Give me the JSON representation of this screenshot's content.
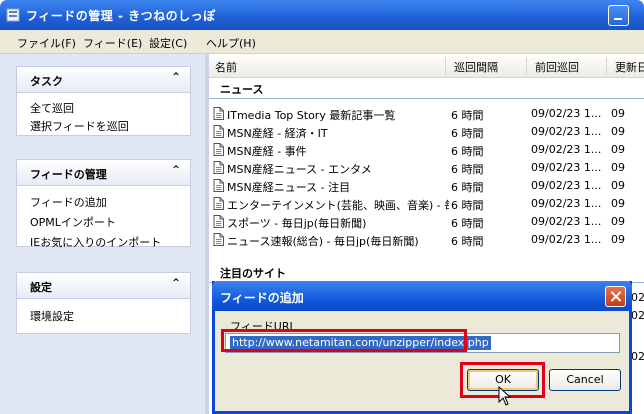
{
  "window": {
    "title": "フィードの管理 - きつねのしっぽ"
  },
  "menu": [
    "ファイル(F)",
    "フィード(E)",
    "設定(C)",
    "ヘルプ(H)"
  ],
  "sidebar": {
    "groups": [
      {
        "title": "タスク",
        "items": [
          "全て巡回",
          "選択フィードを巡回"
        ]
      },
      {
        "title": "フィードの管理",
        "items": [
          "フィードの追加",
          "OPMLインポート",
          "IEお気に入りのインポート"
        ]
      },
      {
        "title": "設定",
        "items": [
          "環境設定"
        ]
      }
    ]
  },
  "list": {
    "columns": [
      "名前",
      "巡回間隔",
      "前回巡回",
      "更新日"
    ],
    "groups": [
      {
        "title": "ニュース",
        "rows": [
          {
            "name": "ITmedia Top Story 最新記事一覧",
            "interval": "6 時間",
            "prev": "09/02/23 1...",
            "upd": "09"
          },
          {
            "name": "MSN産経 - 経済・IT",
            "interval": "6 時間",
            "prev": "09/02/23 1...",
            "upd": "09"
          },
          {
            "name": "MSN産経 - 事件",
            "interval": "6 時間",
            "prev": "09/02/23 1...",
            "upd": "09"
          },
          {
            "name": "MSN産経ニュース - エンタメ",
            "interval": "6 時間",
            "prev": "09/02/23 1...",
            "upd": "09"
          },
          {
            "name": "MSN産経ニュース - 注目",
            "interval": "6 時間",
            "prev": "09/02/23 1...",
            "upd": "09"
          },
          {
            "name": "エンターテインメント(芸能、映画、音楽) - 毎...",
            "interval": "6 時間",
            "prev": "09/02/23 1...",
            "upd": "09"
          },
          {
            "name": "スポーツ - 毎日jp(毎日新聞)",
            "interval": "6 時間",
            "prev": "09/02/23 1...",
            "upd": "09"
          },
          {
            "name": "ニュース速報(総合) - 毎日jp(毎日新聞)",
            "interval": "6 時間",
            "prev": "09/02/23 1...",
            "upd": "09"
          }
        ]
      },
      {
        "title": "注目のサイト",
        "rows": []
      }
    ],
    "partial_dates": [
      "02",
      "02",
      "02"
    ]
  },
  "dialog": {
    "title": "フィードの追加",
    "field_label": "フィードURL",
    "url_value": "http://www.netamitan.com/unzipper/index.php",
    "ok_label": "OK",
    "cancel_label": "Cancel"
  },
  "colors": {
    "titlebar": "#1f5fd6",
    "highlight": "#e0001a",
    "selection": "#316ac5"
  },
  "icons": [
    "app-icon",
    "minimize-icon",
    "collapse-icon",
    "rss-feed-icon",
    "close-icon",
    "mouse-cursor-icon"
  ]
}
